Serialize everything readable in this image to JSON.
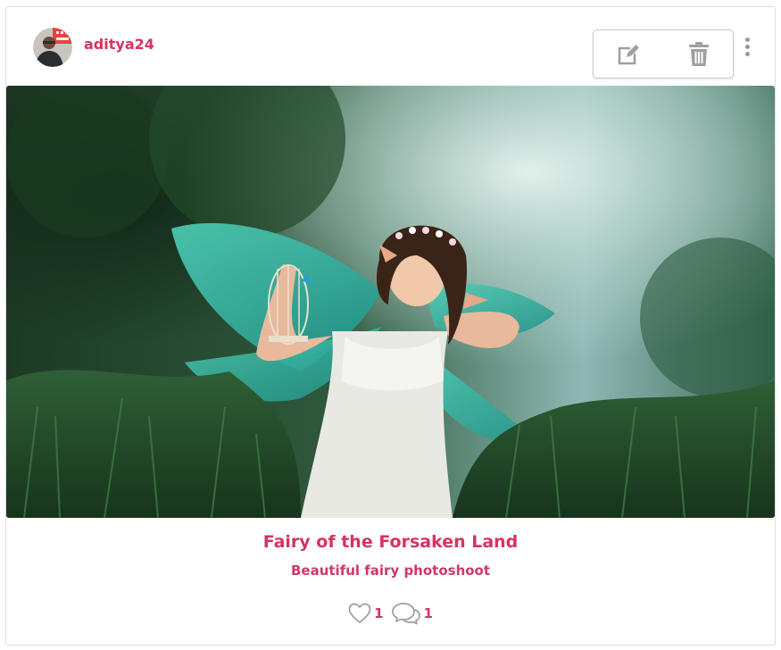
{
  "post": {
    "username": "aditya24",
    "title": "Fairy of the Forsaken Land",
    "description": "Beautiful fairy photoshoot",
    "likes_count": "1",
    "comments_count": "1",
    "image_subject": "fairy-in-grass-photo"
  },
  "icons": {
    "menu": "kebab-menu-icon",
    "edit": "edit-icon",
    "delete": "trash-icon",
    "like": "heart-icon",
    "comment": "comment-icon"
  },
  "colors": {
    "accent": "#d6335f",
    "icon_gray": "#a0a0a0",
    "border": "#dcdce6"
  }
}
